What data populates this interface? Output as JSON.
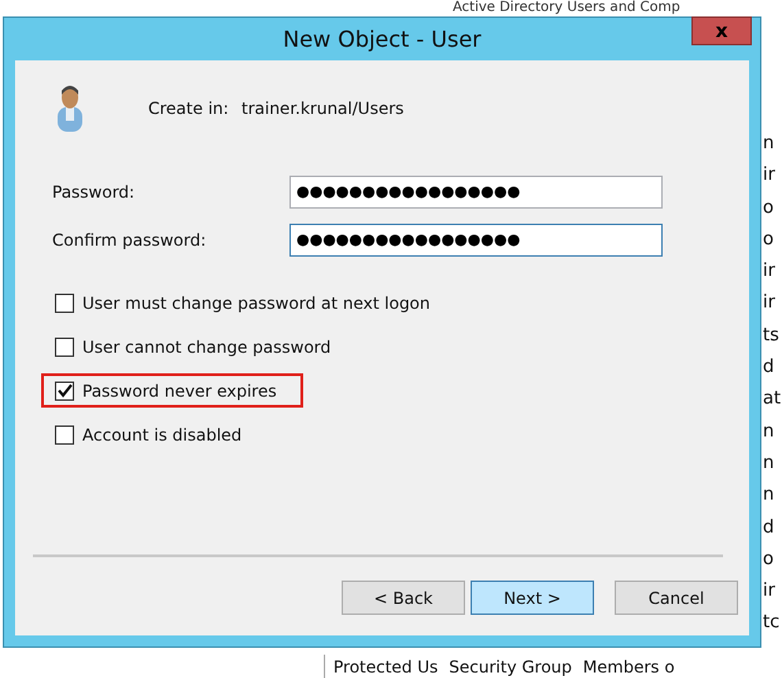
{
  "background_window": {
    "title": "Active Directory Users and Comp",
    "list_fragments": [
      "n",
      "ir",
      "o",
      "o",
      "ir",
      "ir",
      "ts",
      "d",
      "at",
      "n",
      "n",
      "n",
      "d",
      "o",
      "ir",
      "tc"
    ],
    "bottom_row": [
      "Protected Us",
      "Security Group",
      "Members o"
    ]
  },
  "dialog": {
    "title": "New Object - User",
    "close": "x",
    "create_in": {
      "label": "Create in:",
      "value": "trainer.krunal/Users"
    },
    "fields": [
      {
        "label": "Password:",
        "value": "●●●●●●●●●●●●●●●●●",
        "focused": false
      },
      {
        "label": "Confirm password:",
        "value": "●●●●●●●●●●●●●●●●●",
        "focused": true
      }
    ],
    "options": [
      {
        "label": "User must change password at next logon",
        "checked": false,
        "highlighted": false
      },
      {
        "label": "User cannot change password",
        "checked": false,
        "highlighted": false
      },
      {
        "label": "Password never expires",
        "checked": true,
        "highlighted": true
      },
      {
        "label": "Account is disabled",
        "checked": false,
        "highlighted": false
      }
    ],
    "buttons": [
      {
        "label": "< Back",
        "default": false
      },
      {
        "label": "Next >",
        "default": true
      },
      {
        "label": "Cancel",
        "default": false
      }
    ]
  }
}
